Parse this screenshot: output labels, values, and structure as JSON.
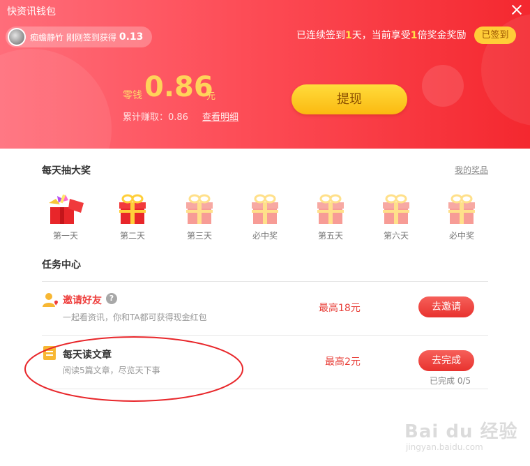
{
  "window": {
    "title": "快资讯钱包"
  },
  "header": {
    "notice": {
      "text": "痴蟾静竹 刚刚签到获得",
      "amount": "0.13"
    },
    "streak": {
      "prefix": "已连续签到",
      "days": "1",
      "mid": "天，当前享受",
      "multiplier": "1",
      "suffix": "倍奖金奖励"
    },
    "signed_label": "已签到",
    "balance": {
      "label": "零钱",
      "value": "0.86",
      "unit": "元"
    },
    "earned": {
      "label": "累计赚取：0.86",
      "detail_link": "查看明细"
    },
    "withdraw_label": "提现",
    "colors": {
      "gradient_start": "#ff6d7a",
      "gradient_end": "#f4282f",
      "accent": "#ffd35a"
    }
  },
  "lottery": {
    "title": "每天抽大奖",
    "my_prize_link": "我的奖品",
    "days": [
      {
        "label": "第一天",
        "state": "opened"
      },
      {
        "label": "第二天",
        "state": "available"
      },
      {
        "label": "第三天",
        "state": "locked"
      },
      {
        "label": "必中奖",
        "state": "locked"
      },
      {
        "label": "第五天",
        "state": "locked"
      },
      {
        "label": "第六天",
        "state": "locked"
      },
      {
        "label": "必中奖",
        "state": "locked"
      }
    ]
  },
  "tasks": {
    "title": "任务中心",
    "items": [
      {
        "name": "邀请好友",
        "desc": "一起看资讯，你和TA都可获得现金红包",
        "reward": "最高18元",
        "button": "去邀请",
        "icon": "invite-user-icon"
      },
      {
        "name": "每天读文章",
        "desc": "阅读5篇文章，尽览天下事",
        "reward": "最高2元",
        "button": "去完成",
        "progress": "已完成 0/5",
        "icon": "article-icon"
      }
    ]
  },
  "watermark": {
    "text": "Bai du 经验",
    "sub": "jingyan.baidu.com"
  }
}
